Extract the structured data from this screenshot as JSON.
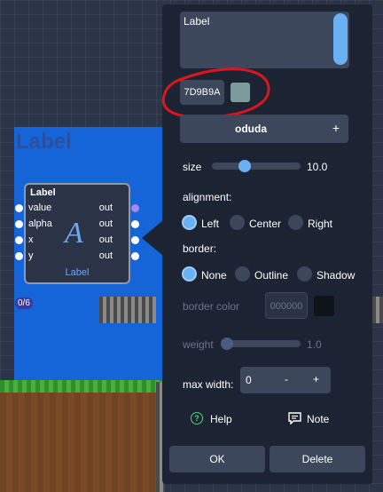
{
  "canvas": {
    "title_text": "Label",
    "counter": "0/6"
  },
  "node": {
    "title": "Label",
    "inputs": [
      "value",
      "alpha",
      "x",
      "y"
    ],
    "outputs": [
      "out",
      "out",
      "out",
      "out"
    ],
    "icon_glyph": "A",
    "subtitle": "Label"
  },
  "panel": {
    "label_text": "Label",
    "color_hex": "7D9B9A",
    "color_swatch": "#7D9B9A",
    "font_value": "oduda",
    "font_plus": "+",
    "size_label": "size",
    "size_value": "10.0",
    "size_level": 0.35,
    "alignment_label": "alignment:",
    "alignment_options": [
      "Left",
      "Center",
      "Right"
    ],
    "alignment_selected": "Left",
    "border_label": "border:",
    "border_options": [
      "None",
      "Outline",
      "Shadow"
    ],
    "border_selected": "None",
    "border_color_label": "border color",
    "border_color_value": "000000",
    "weight_label": "weight",
    "weight_value": "1.0",
    "weight_level": 0.0,
    "max_width_label": "max width:",
    "max_width_value": "0",
    "max_width_minus": "-",
    "max_width_plus": "+",
    "help_label": "Help",
    "note_label": "Note",
    "ok_label": "OK",
    "delete_label": "Delete"
  },
  "colors": {
    "accent": "#6ab0f3",
    "panel_bg": "#1c2433",
    "annotation": "#e0141e"
  }
}
